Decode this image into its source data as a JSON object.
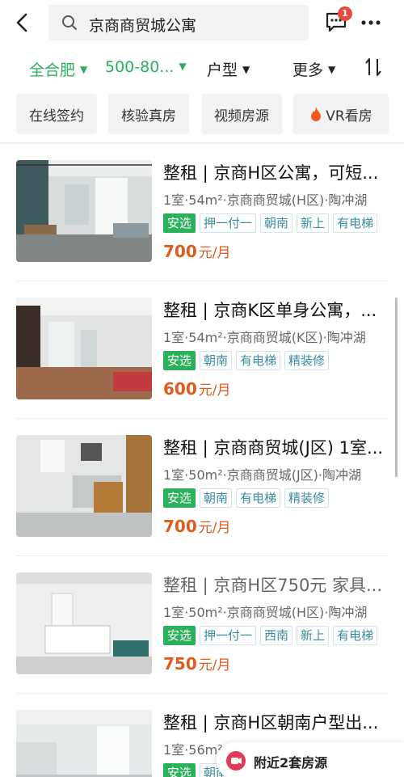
{
  "search": {
    "query": "京商商贸城公寓"
  },
  "header": {
    "badge_count": "1"
  },
  "filters": {
    "city": "全合肥",
    "price": "500-80...",
    "layout": "户型",
    "more": "更多"
  },
  "tags": [
    "在线签约",
    "核验真房",
    "视频房源",
    "VR看房"
  ],
  "listings": [
    {
      "title": "整租 | 京商H区公寓，可短...",
      "meta": "1室·54m²·京商商贸城(H区)·陶冲湖",
      "chips": [
        "安选",
        "押一付一",
        "朝南",
        "新上",
        "有电梯"
      ],
      "price": "700",
      "unit": "元/月"
    },
    {
      "title": "整租 | 京商K区单身公寓，...",
      "meta": "1室·54m²·京商商贸城(K区)·陶冲湖",
      "chips": [
        "安选",
        "朝南",
        "有电梯",
        "精装修"
      ],
      "price": "600",
      "unit": "元/月"
    },
    {
      "title": "整租 | 京商商贸城(J区) 1室...",
      "meta": "1室·50m²·京商商贸城(J区)·陶冲湖",
      "chips": [
        "安选",
        "朝南",
        "有电梯",
        "精装修"
      ],
      "price": "700",
      "unit": "元/月"
    },
    {
      "title": "整租 | 京商H区750元 家具...",
      "meta": "1室·50m²·京商商贸城(H区)·陶冲湖",
      "chips": [
        "安选",
        "押一付一",
        "西南",
        "新上",
        "有电梯"
      ],
      "price": "750",
      "unit": "元/月"
    },
    {
      "title": "整租 | 京商H区朝南户型出...",
      "meta": "1室·56m²·京商商贸城(H区)·陶冲湖",
      "chips": [
        "安选",
        "朝南"
      ],
      "price": "",
      "unit": ""
    }
  ],
  "toast": {
    "text": "附近2套房源"
  },
  "colors": {
    "green": "#2bb05c",
    "price": "#e25a1c",
    "chip_text": "#3a8ca3"
  }
}
